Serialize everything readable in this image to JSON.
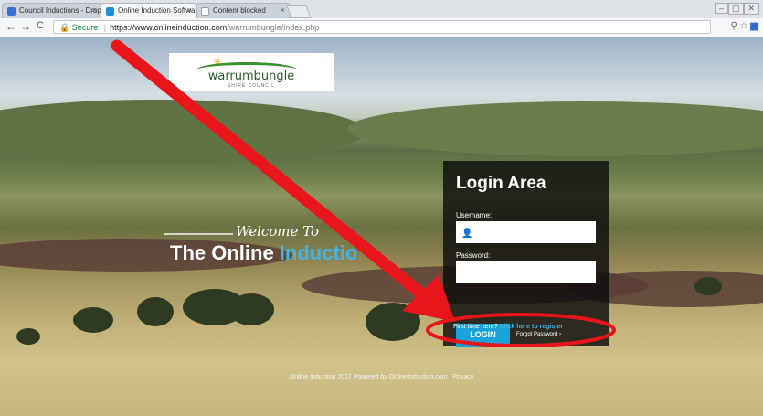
{
  "browser": {
    "tabs": [
      {
        "title": "Council Inductions - Dropb",
        "color": "#3b6fd6"
      },
      {
        "title": "Online Induction Software",
        "color": "#1e90d8"
      },
      {
        "title": "Content blocked",
        "color": "#9aa0a6"
      }
    ],
    "tab_close": "×",
    "nav_back": "←",
    "nav_forward": "→",
    "nav_reload": "C",
    "secure_label": "Secure",
    "url_host": "https://www.onlineinduction.com",
    "url_path": "/warrumbungle/index.php"
  },
  "logo": {
    "name": "warrumbungle",
    "subtitle": "SHIRE COUNCIL"
  },
  "hero": {
    "welcome": "Welcome To",
    "headline_white": "The Online ",
    "headline_blue": "Inductio"
  },
  "login": {
    "title": "Login Area",
    "username_label": "Username:",
    "password_label": "Password:",
    "login_button": "LOGIN",
    "forgot_password": "Forgot Password ›",
    "first_time": "First time here? ",
    "register_link": "Click here to register"
  },
  "footer": {
    "text": "Online Induction 2017 Powered by OnlineInduction.com | Privacy"
  },
  "colors": {
    "accent_blue": "#1aa3d8",
    "annotation_red": "#e8161b"
  }
}
